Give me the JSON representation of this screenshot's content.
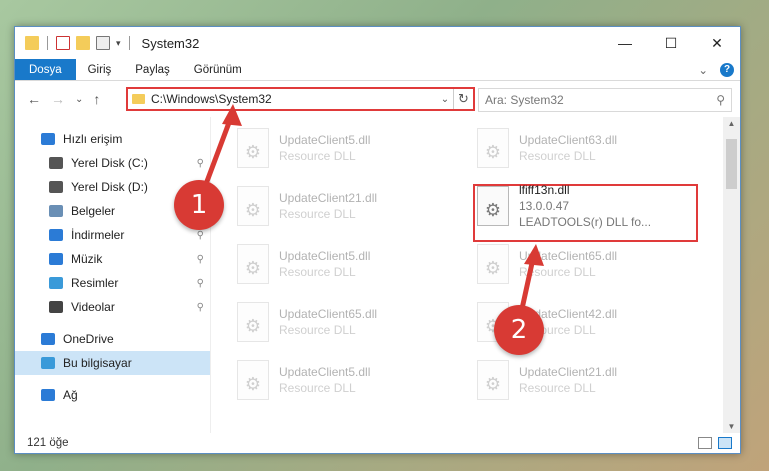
{
  "window": {
    "title": "System32",
    "controls": {
      "minimize": "—",
      "maximize": "☐",
      "close": "✕"
    }
  },
  "ribbon": {
    "tabs": [
      "Dosya",
      "Giriş",
      "Paylaş",
      "Görünüm"
    ],
    "expand": "⌄",
    "help": "?"
  },
  "address": {
    "path": "C:\\Windows\\System32",
    "refresh": "↻",
    "dropdown": "⌄"
  },
  "search": {
    "placeholder": "Ara: System32",
    "icon": "⚲"
  },
  "nav": {
    "back": "←",
    "forward": "→",
    "recent": "⌄",
    "up": "↑"
  },
  "sidebar": {
    "items": [
      {
        "label": "Hızlı erişim",
        "icon": "star-icon",
        "pinned": false,
        "color": "#2b7bd6"
      },
      {
        "label": "Yerel Disk (C:)",
        "icon": "drive-icon",
        "pinned": true,
        "color": "#555555"
      },
      {
        "label": "Yerel Disk (D:)",
        "icon": "drive-icon",
        "pinned": true,
        "color": "#555555"
      },
      {
        "label": "Belgeler",
        "icon": "documents-icon",
        "pinned": true,
        "color": "#6a8fb5"
      },
      {
        "label": "İndirmeler",
        "icon": "downloads-icon",
        "pinned": true,
        "color": "#2b7bd6"
      },
      {
        "label": "Müzik",
        "icon": "music-icon",
        "pinned": true,
        "color": "#2b7bd6"
      },
      {
        "label": "Resimler",
        "icon": "pictures-icon",
        "pinned": true,
        "color": "#3a9ad9"
      },
      {
        "label": "Videolar",
        "icon": "videos-icon",
        "pinned": true,
        "color": "#444444"
      },
      {
        "label": "OneDrive",
        "icon": "onedrive-icon",
        "pinned": false,
        "color": "#2b7bd6"
      },
      {
        "label": "Bu bilgisayar",
        "icon": "computer-icon",
        "pinned": false,
        "color": "#3a9ad9",
        "selected": true
      },
      {
        "label": "Ağ",
        "icon": "network-icon",
        "pinned": false,
        "color": "#2b7bd6"
      }
    ],
    "pin_glyph": "📌"
  },
  "files": [
    {
      "name": "UpdateClient5.dll",
      "sub": "Resource DLL",
      "col": 0,
      "row": 0
    },
    {
      "name": "UpdateClient63.dll",
      "sub": "Resource DLL",
      "col": 1,
      "row": 0
    },
    {
      "name": "UpdateClient21.dll",
      "sub": "Resource DLL",
      "col": 0,
      "row": 1
    },
    {
      "name": "lfiff13n.dll",
      "sub": "13.0.0.47",
      "sub2": "LEADTOOLS(r) DLL fo...",
      "col": 1,
      "row": 1,
      "highlighted": true
    },
    {
      "name": "UpdateClient5.dll",
      "sub": "Resource DLL",
      "col": 0,
      "row": 2
    },
    {
      "name": "UpdateClient65.dll",
      "sub": "Resource DLL",
      "col": 1,
      "row": 2
    },
    {
      "name": "UpdateClient65.dll",
      "sub": "Resource DLL",
      "col": 0,
      "row": 3
    },
    {
      "name": "UpdateClient42.dll",
      "sub": "Resource DLL",
      "col": 1,
      "row": 3
    },
    {
      "name": "UpdateClient5.dll",
      "sub": "Resource DLL",
      "col": 0,
      "row": 4
    },
    {
      "name": "UpdateClient21.dll",
      "sub": "Resource DLL",
      "col": 1,
      "row": 4
    }
  ],
  "status": {
    "count": "121 öğe"
  },
  "steps": [
    "1",
    "2"
  ],
  "colors": {
    "accent": "#1979ca",
    "highlight": "#e03a3a",
    "badge": "#d83a34"
  }
}
